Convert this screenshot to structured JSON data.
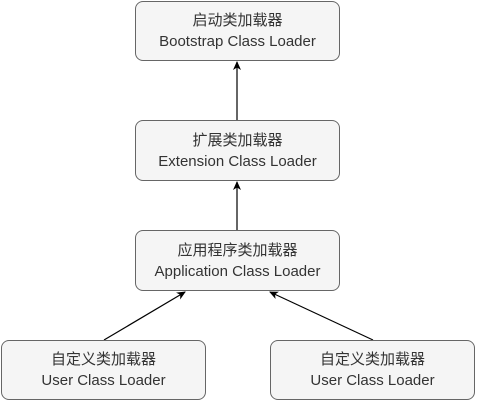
{
  "nodes": {
    "bootstrap": {
      "title_zh": "启动类加载器",
      "title_en": "Bootstrap Class Loader"
    },
    "extension": {
      "title_zh": "扩展类加载器",
      "title_en": "Extension Class Loader"
    },
    "application": {
      "title_zh": "应用程序类加载器",
      "title_en": "Application Class Loader"
    },
    "user_left": {
      "title_zh": "自定义类加载器",
      "title_en": "User Class Loader"
    },
    "user_right": {
      "title_zh": "自定义类加载器",
      "title_en": "User Class Loader"
    }
  },
  "edges": [
    {
      "from": "extension",
      "to": "bootstrap"
    },
    {
      "from": "application",
      "to": "extension"
    },
    {
      "from": "user_left",
      "to": "application"
    },
    {
      "from": "user_right",
      "to": "application"
    }
  ],
  "colors": {
    "node_fill": "#f5f5f5",
    "node_border": "#666666",
    "text": "#333333",
    "arrow": "#000000"
  }
}
